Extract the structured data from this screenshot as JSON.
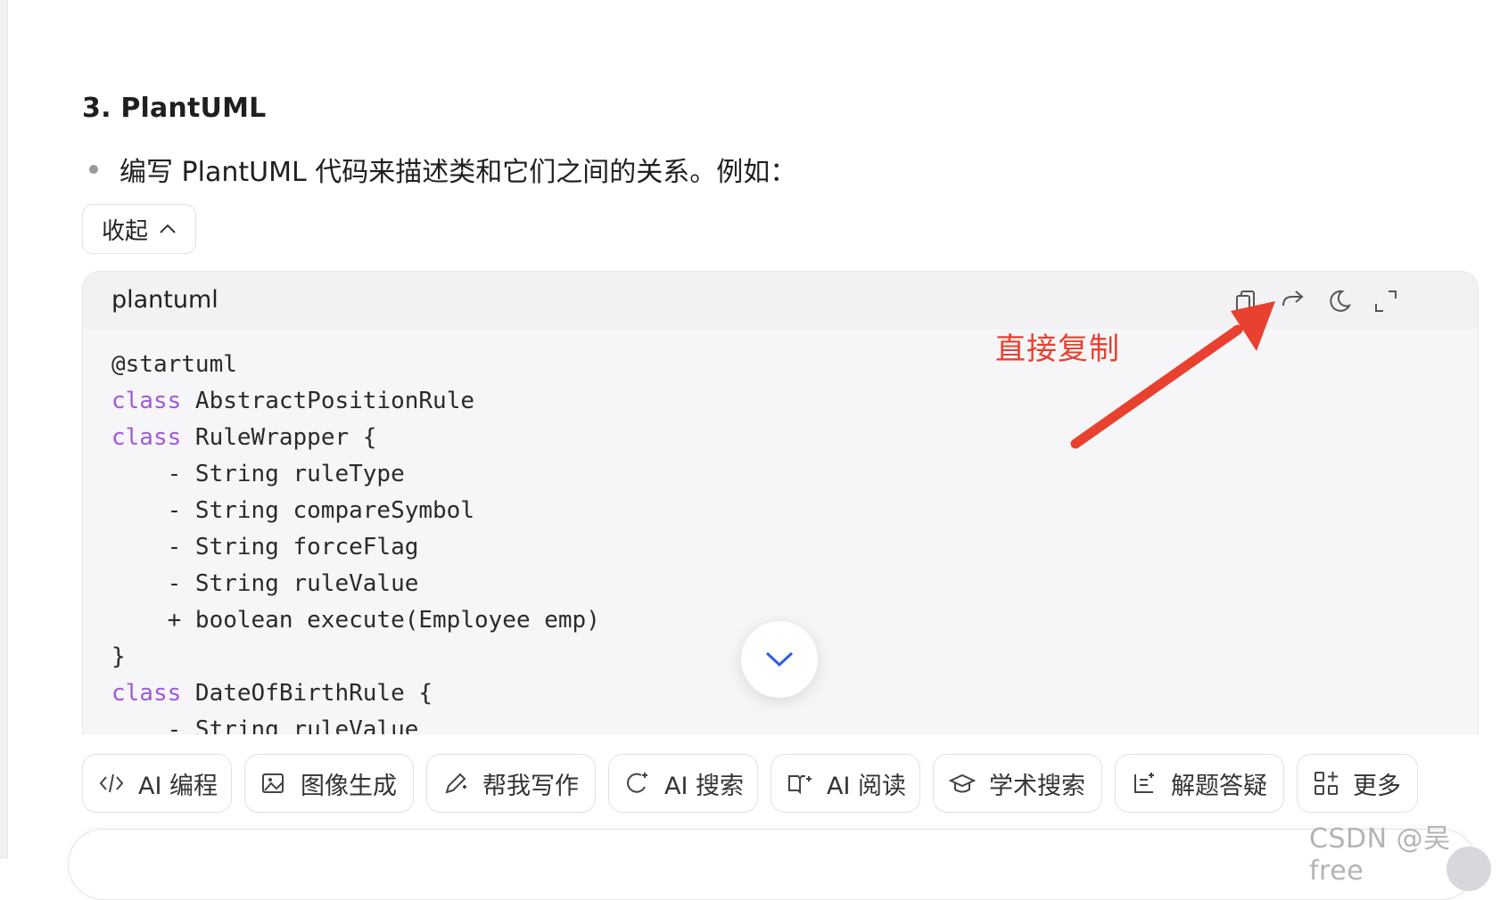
{
  "section": {
    "heading": "3. PlantUML",
    "bullet": "编写 PlantUML 代码来描述类和它们之间的关系。例如："
  },
  "collapse_button": {
    "label": "收起"
  },
  "code_block": {
    "language": "plantuml",
    "tools": [
      "copy-icon",
      "share-icon",
      "theme-moon-icon",
      "expand-icon"
    ],
    "lines": [
      {
        "kw": "",
        "text": "@startuml"
      },
      {
        "kw": "class",
        "text": " AbstractPositionRule"
      },
      {
        "kw": "class",
        "text": " RuleWrapper {"
      },
      {
        "kw": "",
        "text": "    - String ruleType"
      },
      {
        "kw": "",
        "text": "    - String compareSymbol"
      },
      {
        "kw": "",
        "text": "    - String forceFlag"
      },
      {
        "kw": "",
        "text": "    - String ruleValue"
      },
      {
        "kw": "",
        "text": "    + boolean execute(Employee emp)"
      },
      {
        "kw": "",
        "text": "}"
      },
      {
        "kw": "class",
        "text": " DateOfBirthRule {"
      },
      {
        "kw": "",
        "text": "    - String ruleValue"
      }
    ]
  },
  "annotation": {
    "text": "直接复制",
    "color": "#e8412f"
  },
  "toolbar_chips": [
    {
      "icon": "code-icon",
      "label": "AI 编程"
    },
    {
      "icon": "image-gen-icon",
      "label": "图像生成"
    },
    {
      "icon": "pen-write-icon",
      "label": "帮我写作"
    },
    {
      "icon": "ai-search-icon",
      "label": "AI 搜索"
    },
    {
      "icon": "book-read-icon",
      "label": "AI 阅读"
    },
    {
      "icon": "graduation-cap-icon",
      "label": "学术搜索"
    },
    {
      "icon": "solve-icon",
      "label": "解题答疑"
    },
    {
      "icon": "grid-more-icon",
      "label": "更多"
    }
  ],
  "watermark": "CSDN @吴free",
  "colors": {
    "keyword": "#a15ad8",
    "scroll_chevron": "#2b5ce6"
  }
}
